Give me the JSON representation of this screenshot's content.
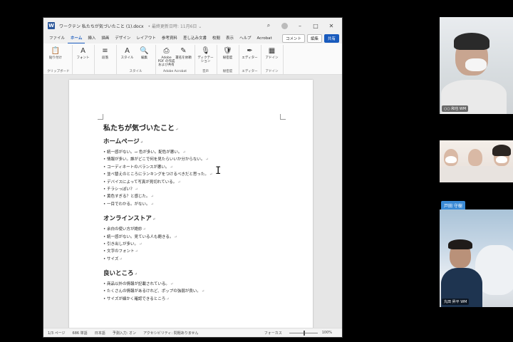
{
  "word": {
    "title_doc": "ワークテン 私たちが気づいたこと (1).docx",
    "title_status": "• 最終更新日時: 11月6日 ⌄",
    "tabs": [
      "ファイル",
      "ホーム",
      "挿入",
      "描画",
      "デザイン",
      "レイアウト",
      "参考資料",
      "差し込み文書",
      "校閲",
      "表示",
      "ヘルプ",
      "Acrobat"
    ],
    "tab_actions": {
      "comment": "コメント",
      "edit": "編集",
      "share": "共有"
    },
    "ribbon_groups": [
      {
        "label": "クリップボード",
        "buttons": [
          {
            "icon": "paste-icon",
            "glyph": "📋",
            "label": "貼り付け"
          }
        ]
      },
      {
        "label": "",
        "buttons": [
          {
            "icon": "font-icon",
            "glyph": "A",
            "label": "フォント"
          }
        ]
      },
      {
        "label": "",
        "buttons": [
          {
            "icon": "paragraph-icon",
            "glyph": "≡",
            "label": "段落"
          }
        ]
      },
      {
        "label": "スタイル",
        "buttons": [
          {
            "icon": "styles-icon",
            "glyph": "A",
            "label": "スタイル"
          },
          {
            "icon": "edit-icon",
            "glyph": "🔍",
            "label": "編集"
          }
        ]
      },
      {
        "label": "Adobe Acrobat",
        "buttons": [
          {
            "icon": "adobe-pdf-icon",
            "glyph": "⎙",
            "label": "Adobe PDF の作成および共有"
          },
          {
            "icon": "signature-icon",
            "glyph": "✎",
            "label": "署名を依頼"
          }
        ]
      },
      {
        "label": "音声",
        "buttons": [
          {
            "icon": "microphone-icon",
            "glyph": "🎙",
            "label": "ディクテーション"
          }
        ]
      },
      {
        "label": "秘密度",
        "buttons": [
          {
            "icon": "sensitivity-icon",
            "glyph": "🛡",
            "label": "秘密度"
          }
        ]
      },
      {
        "label": "エディター",
        "buttons": [
          {
            "icon": "editor-icon",
            "glyph": "✒",
            "label": "エディター"
          }
        ]
      },
      {
        "label": "アドイン",
        "buttons": [
          {
            "icon": "addins-icon",
            "glyph": "▦",
            "label": "アドイン"
          }
        ]
      }
    ],
    "document": {
      "title": "私たちが気づいたこと",
      "sections": [
        {
          "heading": "ホームページ",
          "items": [
            "統一感がない。→ 色が多い。配色が悪い。",
            "情報が多い。誰がどこで何を見たらいいか分からない。",
            "コーディネートのバランスが悪い。",
            "並べ替えのところにランキングをつけるべきだと思った。",
            "デバイスによって写真が見切れている。",
            "チラシっぽい？",
            "黄色すぎる？と感じた。",
            "一目でわかる。がない。"
          ]
        },
        {
          "heading": "オンラインストア",
          "items": [
            "余白の使い方が絶妙",
            "統一感がない。見ている人も飽きる。",
            "引き出しが多い。",
            "文字のフォント",
            "サイズ"
          ]
        },
        {
          "heading": "良いところ",
          "items": [
            "商品以外の情報が記載されている。",
            "たくさんの情報があるけれど、ポップの強弱が良い。",
            "サイズが細かく確認できるところ"
          ]
        }
      ],
      "paragraph_mark": "↵"
    },
    "status": {
      "page": "1/3 ページ",
      "words": "686 単語",
      "lang": "日本語",
      "ime": "予測入力: オン",
      "accessibility": "アクセシビリティ: 問題ありません",
      "focus": "フォーカス",
      "zoom": "100%"
    }
  },
  "participants": [
    {
      "name": "○○ 和也",
      "badge": "WM"
    },
    {
      "name": "",
      "badge": ""
    },
    {
      "name": "丸田 昇平",
      "badge": "WM"
    }
  ],
  "speaker_chip": "戸田 守樹",
  "colors": {
    "word_blue": "#185abd",
    "chip_blue": "#3a8ad6"
  }
}
